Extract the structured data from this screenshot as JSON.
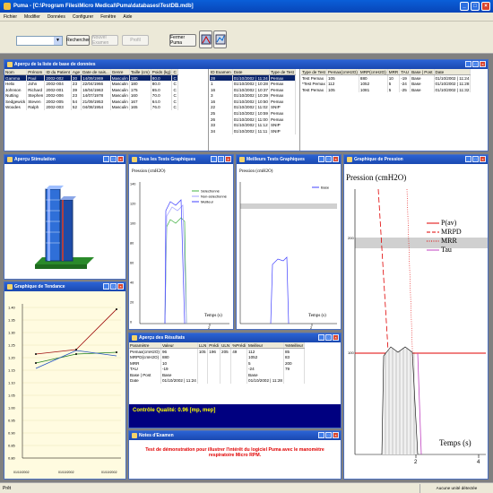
{
  "app": {
    "title": "Puma - [C:\\Program Files\\Micro Medical\\Puma\\databases\\TestDB.mdb]"
  },
  "menu": [
    "Fichier",
    "Modifier",
    "Données",
    "Configurer",
    "Fenêtre",
    "Aide"
  ],
  "toolbar": {
    "search": "Rechercher",
    "new_exam": "Nouvel Examen",
    "profile": "Profil",
    "close": "Fermer Puma"
  },
  "db": {
    "title": "Aperçu de la liste de base de données",
    "pat_cols": [
      "Nom",
      "Prénom",
      "ID du Patient",
      "Age",
      "Date de nais...",
      "Genre",
      "Taille (cm)",
      "Poids (kg)",
      "C"
    ],
    "patients": [
      [
        "Gamma",
        "Paul",
        "2002-002",
        "30",
        "14/09/1969",
        "Masculin",
        "180",
        "80.0",
        "C"
      ],
      [
        "Helix",
        "John",
        "2002-004",
        "23",
        "22/04/1966",
        "Masculin",
        "180",
        "80.0",
        "C"
      ],
      [
        "Johnson",
        "Richard",
        "2002-001",
        "39",
        "16/04/1963",
        "Masculin",
        "175",
        "65.0",
        "C"
      ],
      [
        "Nutting",
        "Stephen",
        "2002-006",
        "23",
        "14/07/1978",
        "Masculin",
        "160",
        "70.0",
        "C"
      ],
      [
        "Sedgewick",
        "Steven",
        "2002-005",
        "54",
        "21/09/1953",
        "Masculin",
        "167",
        "64.0",
        "C"
      ],
      [
        "Woodes",
        "Ralph",
        "2002-003",
        "52",
        "04/08/1954",
        "Masculin",
        "165",
        "76.0",
        "C"
      ]
    ],
    "exam_cols": [
      "ID Examen",
      "Date",
      "Type de Test"
    ],
    "exams": [
      [
        "28",
        "01/10/2002 | 11:24",
        "Pemax"
      ],
      [
        "1",
        "01/10/2002 | 10:28",
        "Pemax"
      ],
      [
        "16",
        "01/10/2002 | 10:37",
        "Pemax"
      ],
      [
        "3",
        "01/10/2002 | 10:39",
        "Pemax"
      ],
      [
        "16",
        "01/10/2002 | 10:50",
        "Pemax"
      ],
      [
        "22",
        "01/10/2002 | 11:02",
        "SNIP"
      ],
      [
        "25",
        "01/10/2002 | 10:59",
        "Pemax"
      ],
      [
        "26",
        "01/10/2002 | 11:00",
        "Pemax"
      ],
      [
        "33",
        "01/10/2002 | 11:12",
        "SNIP"
      ],
      [
        "34",
        "01/10/2002 | 11:11",
        "SNIP"
      ]
    ],
    "test_cols": [
      "Type de Test",
      "Pemax(cmH2O)",
      "MRP(cmH2O)",
      "MRR",
      "TAU",
      "Base | Post",
      "Date"
    ],
    "tests": [
      [
        "Test Pemax",
        "105",
        "880",
        "10",
        "-19",
        "Base",
        "01/10/2002 | 11:24"
      ],
      [
        "*Test Pemax",
        "112",
        "1052",
        "5",
        "-24",
        "Base",
        "01/10/2002 | 11:28"
      ],
      [
        "Test Pemax",
        "105",
        "1081",
        "5",
        "-25",
        "Base",
        "01/10/2002 | 11:32"
      ]
    ]
  },
  "stim": {
    "title": "Aperçu Stimulation"
  },
  "tend": {
    "title": "Graphique de Tendance",
    "yticks": [
      "1.40",
      "1.35",
      "1.30",
      "1.25",
      "1.20",
      "1.15",
      "1.10",
      "1.05",
      "1.00",
      "0.95",
      "0.90",
      "0.85",
      "0.80"
    ],
    "xticks": [
      "01/10/2002",
      "01/10/2002",
      "01/10/2002"
    ]
  },
  "all": {
    "title": "Tous les Tests Graphiques",
    "ylabel": "Pression (cmH2O)",
    "xlabel": "Temps (s)",
    "legend": [
      "Sélectionné",
      "Non-sélectionné",
      "Meilleur"
    ],
    "yticks": [
      "140",
      "120",
      "100",
      "80",
      "60",
      "40",
      "20",
      "0"
    ],
    "xtick": "2"
  },
  "best": {
    "title": "Meilleurs Tests Graphiques",
    "ylabel": "Pression (cmH2O)",
    "xlabel": "Temps (s)",
    "legend": [
      "Base"
    ],
    "xtick": "2"
  },
  "press": {
    "title": "Graphique de Pression",
    "ylabel": "Pression (cmH2O)",
    "xlabel": "Temps (s)",
    "legend": [
      "P(av)",
      "MRPD",
      "MRR",
      "Tau"
    ],
    "yticks": [
      "300",
      "200",
      "100"
    ],
    "xticks": [
      "2",
      "4"
    ]
  },
  "res": {
    "title": "Aperçu des Résultats",
    "cols": [
      "Paramètre",
      "Valeur",
      "LLN",
      "Prédi",
      "ULN",
      "%Prédi",
      "Meilleur",
      "%Meilleur"
    ],
    "rows": [
      [
        "Pemax(cmH2O)",
        "96",
        "105",
        "196",
        "205",
        "49",
        "112",
        "85"
      ],
      [
        "MRPD(cmH2O)",
        "880",
        "",
        "",
        "",
        "",
        "1052",
        "83"
      ],
      [
        "MRR",
        "10",
        "",
        "",
        "",
        "",
        "5",
        "200"
      ],
      [
        "TAU",
        "-19",
        "",
        "",
        "",
        "",
        "-24",
        "79"
      ],
      [
        "Base | Post",
        "Base",
        "",
        "",
        "",
        "",
        "Base",
        ""
      ],
      [
        "Date",
        "01/10/2002 | 11:24",
        "",
        "",
        "",
        "",
        "01/10/2002 | 11:28",
        ""
      ]
    ],
    "quality": "Contrôle Qualité: 0.96   [mp, mep]"
  },
  "notes": {
    "title": "Notes d'Examen",
    "text": "Test de démonstration pour illustrer l'intérêt du logiciel Puma avec le manomètre respiratoire Micro RPM."
  },
  "status": {
    "left": "Prêt",
    "right": "Aucune unité détectée"
  },
  "colors": {
    "accent": "#0a246a",
    "notes_red": "#e00000",
    "pav": "#e00000",
    "mrr": "#e00000",
    "tau": "#c040c0",
    "best": "#4040ff",
    "sel": "#40b040"
  }
}
